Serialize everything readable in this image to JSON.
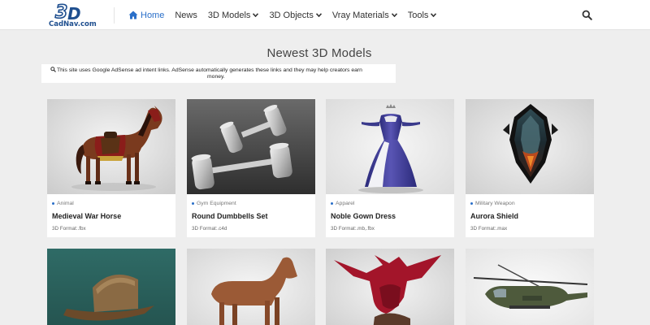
{
  "header": {
    "logo_alt": "3D CadNav.com",
    "nav": [
      {
        "label": "Home",
        "active": true,
        "icon": "home-icon"
      },
      {
        "label": "News",
        "active": false
      },
      {
        "label": "3D Models",
        "active": false,
        "dropdown": true
      },
      {
        "label": "3D Objects",
        "active": false,
        "dropdown": true
      },
      {
        "label": "Vray Materials",
        "active": false,
        "dropdown": true
      },
      {
        "label": "Tools",
        "active": false,
        "dropdown": true
      }
    ],
    "search_icon": "search-icon"
  },
  "main": {
    "title": "Newest 3D Models",
    "notice_line1": "This site uses Google AdSense ad intent links. AdSense automatically generates these links and they may help creators earn",
    "notice_line2": "money."
  },
  "models": [
    {
      "category": "Animal",
      "name": "Medieval War Horse",
      "format": "3D Format:.fbx"
    },
    {
      "category": "Gym Equipment",
      "name": "Round Dumbbells Set",
      "format": "3D Format:.c4d"
    },
    {
      "category": "Apparel",
      "name": "Noble Gown Dress",
      "format": "3D Format:.mb,.fbx"
    },
    {
      "category": "Military Weapon",
      "name": "Aurora Shield",
      "format": "3D Format:.max"
    }
  ],
  "colors": {
    "accent": "#2a6fc9",
    "page_bg": "#eeeeee",
    "card_bg": "#ffffff"
  }
}
